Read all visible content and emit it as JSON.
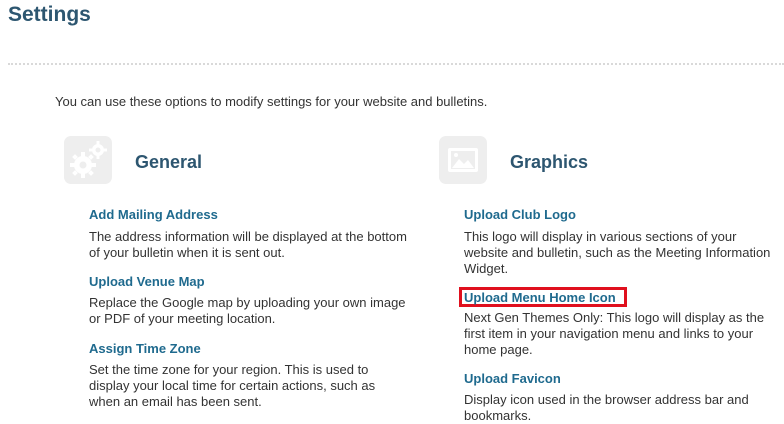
{
  "page": {
    "title": "Settings",
    "intro": "You can use these options to modify settings for your website and bulletins."
  },
  "sections": [
    {
      "title": "General",
      "icon": "gears-icon",
      "items": [
        {
          "label": "Add Mailing Address",
          "desc_lines": [
            "The address information will be displayed at the bottom",
            "of your bulletin when it is sent out."
          ]
        },
        {
          "label": "Upload Venue Map",
          "desc_lines": [
            "Replace the Google map by uploading your own image",
            "or PDF of your meeting location."
          ]
        },
        {
          "label": "Assign Time Zone",
          "desc_lines": [
            "Set the time zone for your region. This is used to",
            "display your local time for certain actions, such as",
            "when an email has been sent."
          ]
        }
      ]
    },
    {
      "title": "Graphics",
      "icon": "image-icon",
      "items": [
        {
          "label": "Upload Club Logo",
          "desc_lines": [
            "This logo will display in various sections of your",
            "website and bulletin, such as the Meeting Information",
            "Widget."
          ]
        },
        {
          "label": "Upload Menu Home Icon",
          "desc_lines": [
            "Next Gen Themes Only: This logo will display as the",
            "first item in your navigation menu and links to your",
            "home page."
          ],
          "highlighted": true
        },
        {
          "label": "Upload Favicon",
          "desc_lines": [
            "Display icon used in the browser address bar and",
            "bookmarks."
          ]
        }
      ]
    }
  ],
  "colors": {
    "heading": "#2d5670",
    "link": "#1f6a8e",
    "highlight_border": "#e0101e",
    "icon_bg": "#eeeeee"
  }
}
